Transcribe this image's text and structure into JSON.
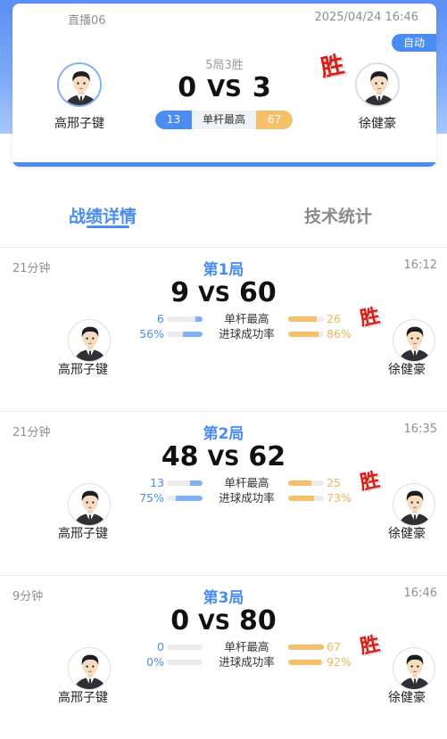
{
  "header": {
    "live_label": "直播06",
    "datetime": "2025/04/24 16:46",
    "auto_badge": "自动",
    "rule": "5局3胜",
    "score_left": "0",
    "vs": "VS",
    "score_right": "3",
    "best_break_left": "13",
    "best_break_label": "单杆最高",
    "best_break_right": "67",
    "winner_mark": "胜"
  },
  "players": {
    "left": "高邢子键",
    "right": "徐健豪"
  },
  "tabs": [
    {
      "label": "战绩详情",
      "active": true
    },
    {
      "label": "技术统计",
      "active": false
    }
  ],
  "stat_labels": {
    "best_break": "单杆最高",
    "pot_success": "进球成功率"
  },
  "games": [
    {
      "title": "第1局",
      "duration": "21分钟",
      "time": "16:12",
      "score_left": "9",
      "vs": "VS",
      "score_right": "60",
      "winner": "right",
      "winner_mark": "胜",
      "best_break_left": "6",
      "best_break_right": "26",
      "best_break_left_ratio": 0.19,
      "best_break_right_ratio": 0.81,
      "pot_left": "56%",
      "pot_right": "86%",
      "pot_left_ratio": 0.56,
      "pot_right_ratio": 0.86
    },
    {
      "title": "第2局",
      "duration": "21分钟",
      "time": "16:35",
      "score_left": "48",
      "vs": "VS",
      "score_right": "62",
      "winner": "right",
      "winner_mark": "胜",
      "best_break_left": "13",
      "best_break_right": "25",
      "best_break_left_ratio": 0.34,
      "best_break_right_ratio": 0.66,
      "pot_left": "75%",
      "pot_right": "73%",
      "pot_left_ratio": 0.75,
      "pot_right_ratio": 0.73
    },
    {
      "title": "第3局",
      "duration": "9分钟",
      "time": "16:46",
      "score_left": "0",
      "vs": "VS",
      "score_right": "80",
      "winner": "right",
      "winner_mark": "胜",
      "best_break_left": "0",
      "best_break_right": "67",
      "best_break_left_ratio": 0.0,
      "best_break_right_ratio": 1.0,
      "pot_left": "0%",
      "pot_right": "92%",
      "pot_left_ratio": 0.0,
      "pot_right_ratio": 0.92
    }
  ],
  "colors": {
    "accent_blue": "#4a8cf0",
    "accent_orange": "#f6c06b",
    "winner_red": "#d71f18"
  }
}
